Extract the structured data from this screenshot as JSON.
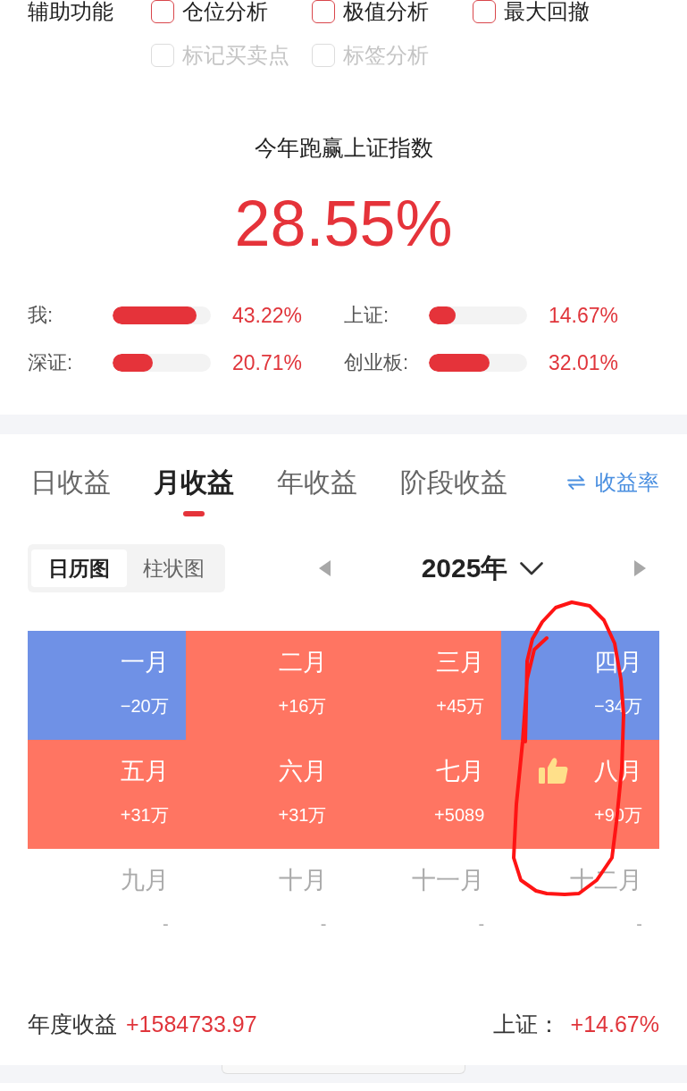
{
  "assist": {
    "label": "辅助功能",
    "options": [
      {
        "label": "仓位分析",
        "checked": false,
        "disabled": false
      },
      {
        "label": "极值分析",
        "checked": false,
        "disabled": false
      },
      {
        "label": "最大回撤",
        "checked": false,
        "disabled": false
      },
      {
        "label": "标记买卖点",
        "checked": false,
        "disabled": true
      },
      {
        "label": "标签分析",
        "checked": false,
        "disabled": true
      }
    ]
  },
  "summary": {
    "title": "今年跑赢上证指数",
    "value": "28.55%"
  },
  "comparisons": [
    {
      "label": "我:",
      "level": 0.85,
      "value": "43.22%"
    },
    {
      "label": "上证:",
      "level": 0.27,
      "value": "14.67%"
    },
    {
      "label": "深证:",
      "level": 0.41,
      "value": "20.71%"
    },
    {
      "label": "创业板:",
      "level": 0.62,
      "value": "32.01%"
    }
  ],
  "tabs": [
    {
      "label": "日收益",
      "selected": false
    },
    {
      "label": "月收益",
      "selected": true
    },
    {
      "label": "年收益",
      "selected": false
    },
    {
      "label": "阶段收益",
      "selected": false
    }
  ],
  "rate_toggle": {
    "label": "收益率"
  },
  "view_switch": [
    {
      "label": "日历图",
      "selected": true
    },
    {
      "label": "柱状图",
      "selected": false
    }
  ],
  "year_picker": {
    "label": "2025年"
  },
  "months": [
    {
      "name": "一月",
      "value": "−20万",
      "color": "#6f91e6",
      "best": false
    },
    {
      "name": "二月",
      "value": "+16万",
      "color": "#ff7562",
      "best": false
    },
    {
      "name": "三月",
      "value": "+45万",
      "color": "#ff7562",
      "best": false
    },
    {
      "name": "四月",
      "value": "−34万",
      "color": "#6f91e6",
      "best": false
    },
    {
      "name": "五月",
      "value": "+31万",
      "color": "#ff7562",
      "best": false
    },
    {
      "name": "六月",
      "value": "+31万",
      "color": "#ff7562",
      "best": false
    },
    {
      "name": "七月",
      "value": "+5089",
      "color": "#ff7562",
      "best": false
    },
    {
      "name": "八月",
      "value": "+90万",
      "color": "#ff7562",
      "best": true
    },
    {
      "name": "九月",
      "value": "-",
      "best": false
    },
    {
      "name": "十月",
      "value": "-",
      "best": false
    },
    {
      "name": "十一月",
      "value": "-",
      "best": false
    },
    {
      "name": "十二月",
      "value": "-",
      "best": false
    }
  ],
  "footer": {
    "label": "年度收益",
    "value": "+1584733.97",
    "index_label": "上证：",
    "index_value": "+14.67%"
  }
}
